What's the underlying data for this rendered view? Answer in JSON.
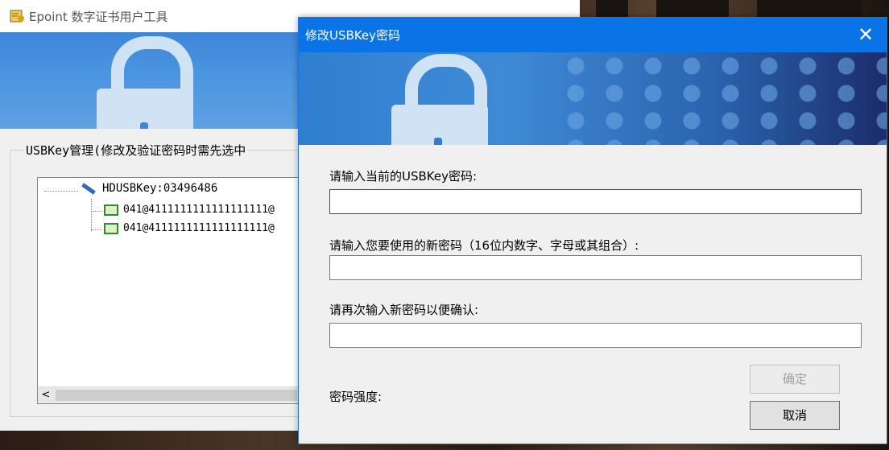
{
  "main_window": {
    "title": "Epoint 数字证书用户工具",
    "group_label": "USBKey管理(修改及验证密码时需先选中",
    "tree": {
      "root_label": "HDUSBKey:03496486",
      "certs": [
        "041@4111111111111111111@",
        "041@4111111111111111111@"
      ]
    },
    "scroll_left": "<"
  },
  "dialog": {
    "title": "修改USBKey密码",
    "close_glyph": "✕",
    "current_password_label": "请输入当前的USBKey密码:",
    "new_password_label": "请输入您要使用的新密码（16位内数字、字母或其组合）:",
    "confirm_password_label": "请再次输入新密码以便确认:",
    "strength_label": "密码强度:",
    "ok_button": "确定",
    "cancel_button": "取消",
    "current_password_value": "",
    "new_password_value": "",
    "confirm_password_value": ""
  },
  "icons": {
    "app": "certificate-app-icon",
    "key": "usb-key-icon",
    "cert": "certificate-icon"
  },
  "colors": {
    "dialog_titlebar": "#0a73e5",
    "banner_blue": "#3f86d8"
  }
}
